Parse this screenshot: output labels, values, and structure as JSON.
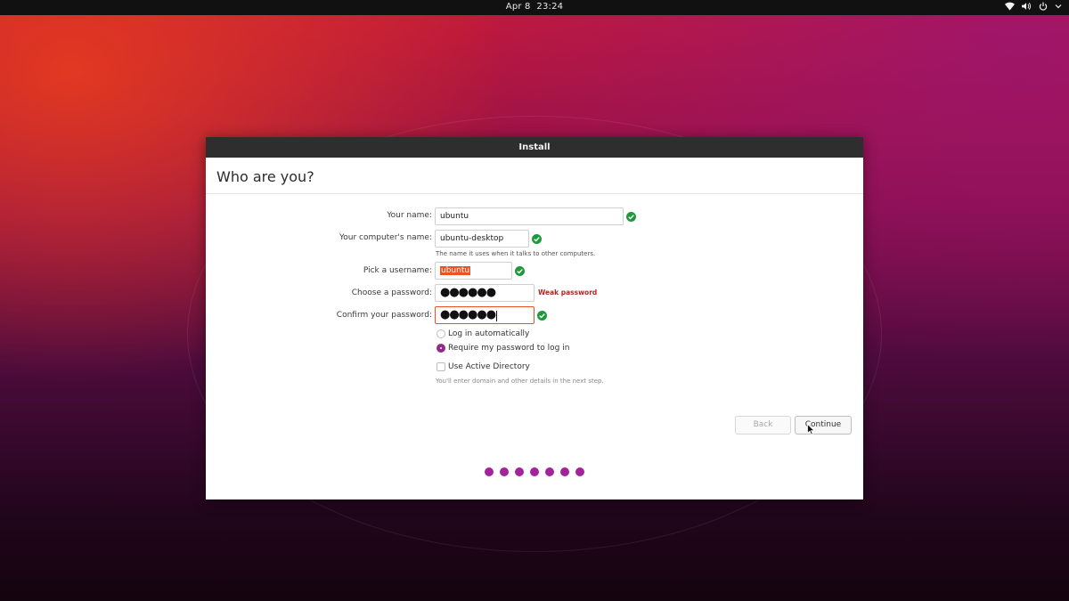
{
  "topbar": {
    "date": "Apr 8",
    "time": "23:24",
    "icons": [
      "wifi-icon",
      "volume-icon",
      "power-icon"
    ]
  },
  "window": {
    "title": "Install",
    "heading": "Who are you?"
  },
  "form": {
    "name": {
      "label": "Your name:",
      "value": "ubuntu"
    },
    "computer": {
      "label": "Your computer's name:",
      "value": "ubuntu-desktop",
      "hint": "The name it uses when it talks to other computers."
    },
    "username": {
      "label": "Pick a username:",
      "value": "ubuntu"
    },
    "password": {
      "label": "Choose a password:",
      "value": "●●●●●●",
      "strength": "Weak password"
    },
    "confirm": {
      "label": "Confirm your password:",
      "value": "●●●●●●"
    },
    "login_auto": "Log in automatically",
    "login_password": "Require my password to log in",
    "active_directory": "Use Active Directory",
    "ad_hint": "You'll enter domain and other details in the next step."
  },
  "buttons": {
    "back": "Back",
    "continue": "Continue"
  },
  "progress": {
    "steps": 7
  },
  "colors": {
    "accent": "#e95420",
    "aubergine": "#a3239a",
    "check": "#1f9a3a",
    "weak": "#b3261e"
  }
}
